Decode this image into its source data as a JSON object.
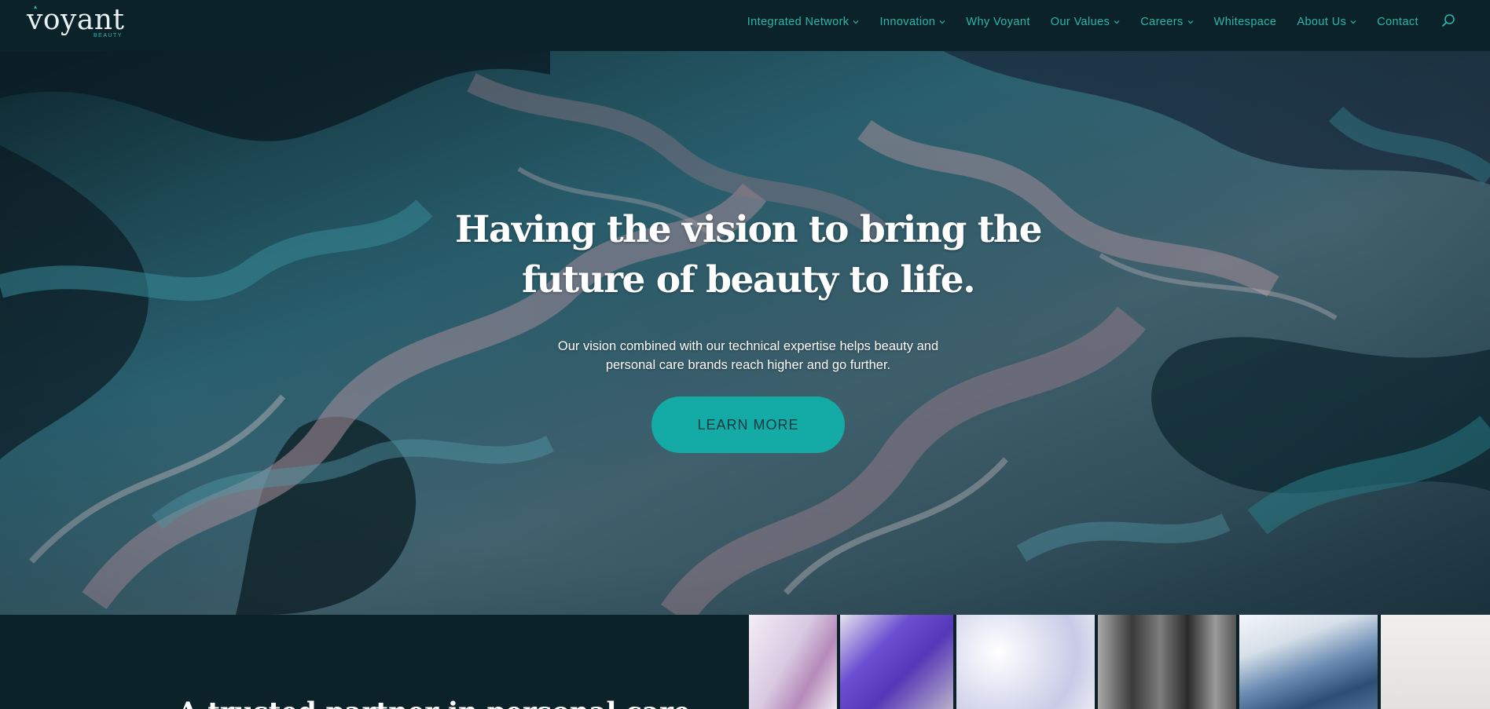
{
  "brand": {
    "name": "voyant",
    "tagline": "BEAUTY"
  },
  "nav": {
    "items": [
      {
        "label": "Integrated Network",
        "has_dropdown": true
      },
      {
        "label": "Innovation",
        "has_dropdown": true
      },
      {
        "label": "Why Voyant",
        "has_dropdown": false
      },
      {
        "label": "Our Values",
        "has_dropdown": true
      },
      {
        "label": "Careers",
        "has_dropdown": true
      },
      {
        "label": "Whitespace",
        "has_dropdown": false
      },
      {
        "label": "About Us",
        "has_dropdown": true
      },
      {
        "label": "Contact",
        "has_dropdown": false
      }
    ],
    "search_icon": "search-icon"
  },
  "hero": {
    "title_line1": "Having the vision to bring the",
    "title_line2": "future of beauty to life.",
    "subtitle": "Our vision combined with our technical expertise helps beauty and personal care brands reach higher and go further.",
    "cta_label": "LEARN MORE"
  },
  "lower": {
    "heading": "A trusted partner in personal care"
  },
  "colors": {
    "header_bg": "#0b2328",
    "nav_text": "#2bb5ad",
    "accent": "#14aba6",
    "cta_text": "#0e3a40"
  }
}
